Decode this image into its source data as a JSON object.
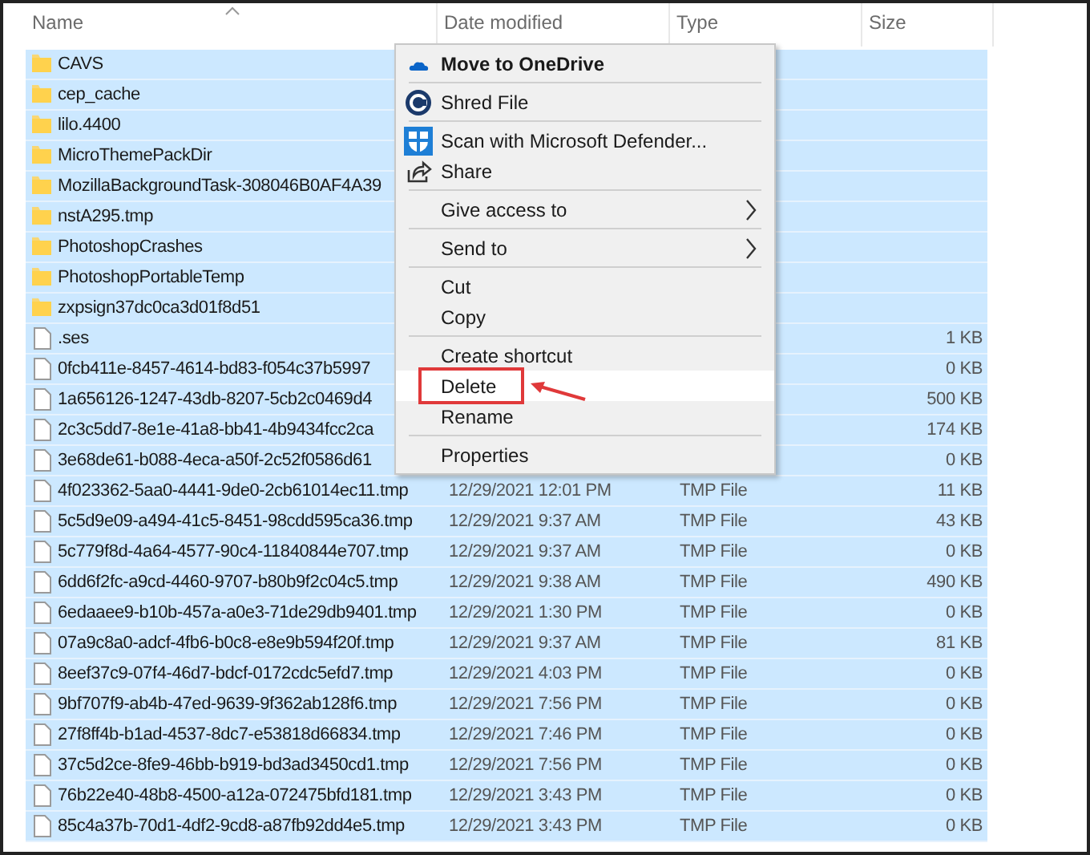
{
  "columns": [
    {
      "label": "Name"
    },
    {
      "label": "Date modified"
    },
    {
      "label": "Type"
    },
    {
      "label": "Size"
    }
  ],
  "rows": [
    {
      "kind": "folder",
      "name": "CAVS",
      "selected": true
    },
    {
      "kind": "folder",
      "name": "cep_cache",
      "selected": true
    },
    {
      "kind": "folder",
      "name": "lilo.4400",
      "selected": true
    },
    {
      "kind": "folder",
      "name": "MicroThemePackDir",
      "selected": true
    },
    {
      "kind": "folder",
      "name": "MozillaBackgroundTask-308046B0AF4A39",
      "selected": true
    },
    {
      "kind": "folder",
      "name": "nstA295.tmp",
      "selected": true
    },
    {
      "kind": "folder",
      "name": "PhotoshopCrashes",
      "selected": true
    },
    {
      "kind": "folder",
      "name": "PhotoshopPortableTemp",
      "selected": true
    },
    {
      "kind": "folder",
      "name": "zxpsign37dc0ca3d01f8d51",
      "selected": true
    },
    {
      "kind": "file",
      "name": ".ses",
      "size": "1 KB",
      "selected": true
    },
    {
      "kind": "file",
      "name": "0fcb411e-8457-4614-bd83-f054c37b5997",
      "size": "0 KB",
      "selected": true
    },
    {
      "kind": "file",
      "name": "1a656126-1247-43db-8207-5cb2c0469d4",
      "size": "500 KB",
      "selected": true
    },
    {
      "kind": "file",
      "name": "2c3c5dd7-8e1e-41a8-bb41-4b9434fcc2ca",
      "size": "174 KB",
      "selected": true
    },
    {
      "kind": "file",
      "name": "3e68de61-b088-4eca-a50f-2c52f0586d61",
      "size": "0 KB",
      "selected": true
    },
    {
      "kind": "file",
      "name": "4f023362-5aa0-4441-9de0-2cb61014ec11.tmp",
      "date": "12/29/2021 12:01 PM",
      "type": "TMP File",
      "size": "11 KB",
      "selected": true
    },
    {
      "kind": "file",
      "name": "5c5d9e09-a494-41c5-8451-98cdd595ca36.tmp",
      "date": "12/29/2021 9:37 AM",
      "type": "TMP File",
      "size": "43 KB",
      "selected": true
    },
    {
      "kind": "file",
      "name": "5c779f8d-4a64-4577-90c4-11840844e707.tmp",
      "date": "12/29/2021 9:37 AM",
      "type": "TMP File",
      "size": "0 KB",
      "selected": true
    },
    {
      "kind": "file",
      "name": "6dd6f2fc-a9cd-4460-9707-b80b9f2c04c5.tmp",
      "date": "12/29/2021 9:38 AM",
      "type": "TMP File",
      "size": "490 KB",
      "selected": true
    },
    {
      "kind": "file",
      "name": "6edaaee9-b10b-457a-a0e3-71de29db9401.tmp",
      "date": "12/29/2021 1:30 PM",
      "type": "TMP File",
      "size": "0 KB",
      "selected": true
    },
    {
      "kind": "file",
      "name": "07a9c8a0-adcf-4fb6-b0c8-e8e9b594f20f.tmp",
      "date": "12/29/2021 9:37 AM",
      "type": "TMP File",
      "size": "81 KB",
      "selected": true
    },
    {
      "kind": "file",
      "name": "8eef37c9-07f4-46d7-bdcf-0172cdc5efd7.tmp",
      "date": "12/29/2021 4:03 PM",
      "type": "TMP File",
      "size": "0 KB",
      "selected": true
    },
    {
      "kind": "file",
      "name": "9bf707f9-ab4b-47ed-9639-9f362ab128f6.tmp",
      "date": "12/29/2021 7:56 PM",
      "type": "TMP File",
      "size": "0 KB",
      "selected": true
    },
    {
      "kind": "file",
      "name": "27f8ff4b-b1ad-4537-8dc7-e53818d66834.tmp",
      "date": "12/29/2021 7:46 PM",
      "type": "TMP File",
      "size": "0 KB",
      "selected": true
    },
    {
      "kind": "file",
      "name": "37c5d2ce-8fe9-46bb-b919-bd3ad3450cd1.tmp",
      "date": "12/29/2021 7:56 PM",
      "type": "TMP File",
      "size": "0 KB",
      "selected": true
    },
    {
      "kind": "file",
      "name": "76b22e40-48b8-4500-a12a-072475bfd181.tmp",
      "date": "12/29/2021 3:43 PM",
      "type": "TMP File",
      "size": "0 KB",
      "selected": true
    },
    {
      "kind": "file",
      "name": "85c4a37b-70d1-4df2-9cd8-a87fb92dd4e5.tmp",
      "date": "12/29/2021 3:43 PM",
      "type": "TMP File",
      "size": "0 KB",
      "selected": true
    }
  ],
  "context_menu": {
    "groups": [
      [
        {
          "label": "Move to OneDrive",
          "default": true,
          "submenu": false,
          "highlighted": false
        }
      ],
      [
        {
          "label": "Shred File",
          "default": false,
          "submenu": false,
          "highlighted": false
        }
      ],
      [
        {
          "label": "Scan with Microsoft Defender...",
          "default": false,
          "submenu": false,
          "highlighted": false
        },
        {
          "label": "Share",
          "default": false,
          "submenu": false,
          "highlighted": false
        }
      ],
      [
        {
          "label": "Give access to",
          "default": false,
          "submenu": true,
          "highlighted": false
        }
      ],
      [
        {
          "label": "Send to",
          "default": false,
          "submenu": true,
          "highlighted": false
        }
      ],
      [
        {
          "label": "Cut",
          "default": false,
          "submenu": false,
          "highlighted": false
        },
        {
          "label": "Copy",
          "default": false,
          "submenu": false,
          "highlighted": false
        }
      ],
      [
        {
          "label": "Create shortcut",
          "default": false,
          "submenu": false,
          "highlighted": false
        },
        {
          "label": "Delete",
          "default": false,
          "submenu": false,
          "highlighted": true,
          "annotated": true
        },
        {
          "label": "Rename",
          "default": false,
          "submenu": false,
          "highlighted": false
        }
      ],
      [
        {
          "label": "Properties",
          "default": false,
          "submenu": false,
          "highlighted": false
        }
      ]
    ]
  }
}
